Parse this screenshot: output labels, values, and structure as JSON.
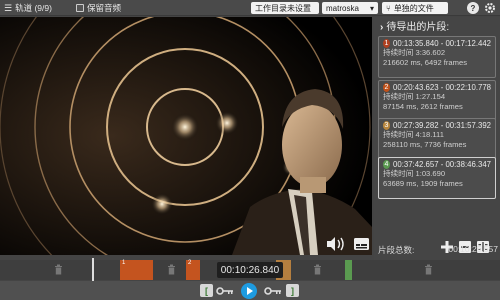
{
  "topbar": {
    "track_label": "轨道 (9/9)",
    "keep_audio_label": "保留音频",
    "workdir_label": "工作目录未设置",
    "format_value": "matroska",
    "format_arrow": "▾",
    "separate_files_label": "单独的文件",
    "help_label": "?",
    "settings_icon": "gear-icon"
  },
  "panel": {
    "title": "待导出的片段:",
    "segments": [
      {
        "num": "1",
        "range": "00:13:35.840 - 00:17:12.442",
        "duration": "持续时间 3:36.602",
        "detail": "216602 ms, 6492 frames",
        "color": "#b04020"
      },
      {
        "num": "2",
        "range": "00:20:43.623 - 00:22:10.778",
        "duration": "持续时间 1:27.154",
        "detail": "87154 ms, 2612 frames",
        "color": "#c05018"
      },
      {
        "num": "3",
        "range": "00:27:39.282 - 00:31:57.392",
        "duration": "持续时间 4:18.111",
        "detail": "258110 ms, 7736 frames",
        "color": "#b8863c"
      },
      {
        "num": "4",
        "range": "00:37:42.657 - 00:38:46.347",
        "duration": "持续时间 1:03.690",
        "detail": "63689 ms, 1909 frames",
        "color": "#5a9a50"
      }
    ],
    "footer_label": "片段总数:",
    "footer_value": "00:10:25.557"
  },
  "timeline": {
    "timecode": "00:10:26.840",
    "segment_labels": [
      "1",
      "2"
    ]
  },
  "colors": {
    "accent_blue": "#1e9be0",
    "segment_orange": "#c4541f",
    "segment_selected": "#b57f3f",
    "segment_green": "#5a9a50"
  }
}
